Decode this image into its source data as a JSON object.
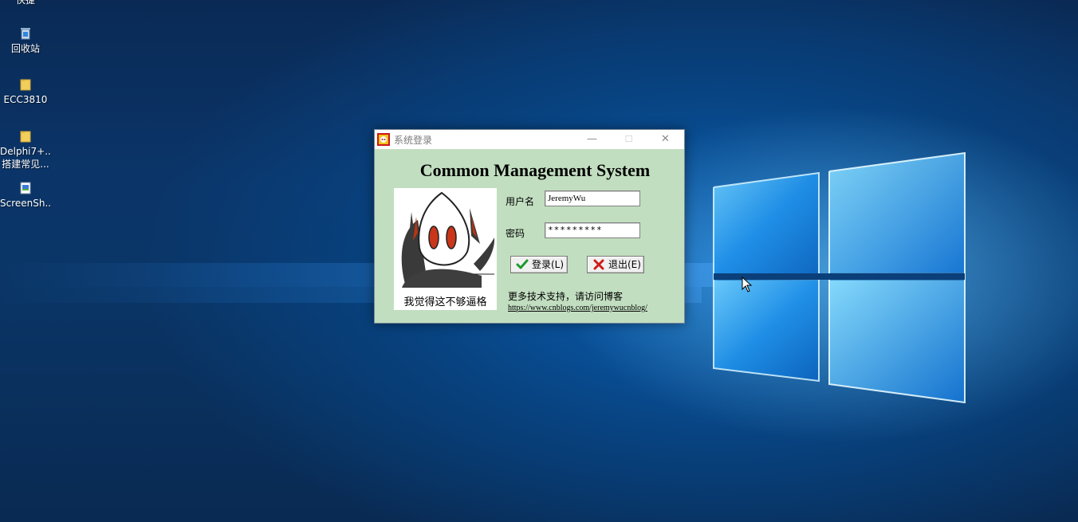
{
  "desktop": {
    "top_cut_label": "快捷",
    "icons": [
      {
        "label": "回收站",
        "icon": "recycle-bin-icon"
      },
      {
        "label": "ECC3810",
        "icon": "folder-icon"
      },
      {
        "label": "Delphi7+...",
        "label2": "搭建常见...",
        "icon": "folder-icon"
      },
      {
        "label": "ScreenSh...",
        "icon": "image-file-icon"
      }
    ]
  },
  "dialog": {
    "title": "系统登录",
    "minimize": "—",
    "maximize": "☐",
    "close": "✕",
    "app_title": "Common Management System",
    "meme_caption": "我觉得这不够逼格",
    "username_label": "用户名",
    "username_value": "JeremyWu",
    "password_label": "密码",
    "password_value": "*********",
    "login_button": "登录(L)",
    "exit_button": "退出(E)",
    "support_text": "更多技术支持，请访问博客",
    "blog_url": "https://www.cnblogs.com/jeremywucnblog/"
  },
  "colors": {
    "dialog_bg": "#c2dec0",
    "desktop_bg": "#0b3569",
    "login_check": "#1c9a2e",
    "exit_cross": "#d11a1a"
  }
}
